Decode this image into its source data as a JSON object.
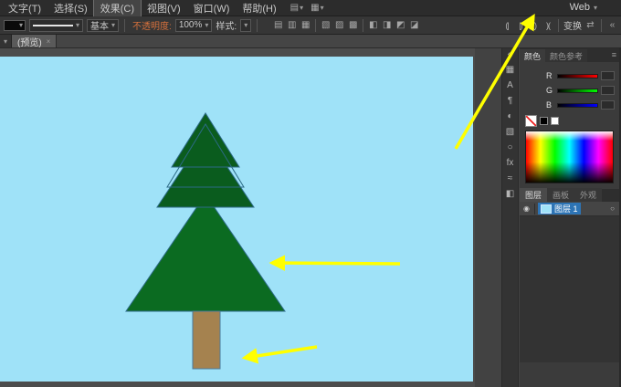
{
  "menu_bar": {
    "items": [
      "文字(T)",
      "选择(S)",
      "效果(C)",
      "视图(V)",
      "窗口(W)",
      "帮助(H)"
    ],
    "workspace_label": "Web"
  },
  "glyphs": {
    "down": "▾",
    "close": "×",
    "collapse": "«",
    "menu": "≡",
    "eye": "◉",
    "target": "○",
    "doc": "▤",
    "layout": "▦",
    "swap": "⇄"
  },
  "control_bar": {
    "stroke_preset": "基本",
    "opacity_label": "不透明度:",
    "opacity_value": "100%",
    "style_label": "样式:",
    "transform_label": "变换",
    "align_icons": [
      "▤",
      "▥",
      "▦"
    ],
    "distribute_icons": [
      "▧",
      "▨",
      "▩"
    ],
    "path_icons": [
      "◧",
      "◨",
      "◩",
      "◪"
    ],
    "bracket_icons": [
      "(|",
      "|)",
      "()",
      ")("
    ]
  },
  "tab_bar": {
    "tab_label": "(预览)"
  },
  "dock_icons": [
    "▦",
    "A",
    "¶",
    "◐",
    "▧",
    "○",
    "fx",
    "≈",
    "◧"
  ],
  "panels": {
    "color": {
      "tab": "颜色",
      "tab_guide": "颜色参考",
      "channels": [
        "R",
        "G",
        "B"
      ]
    },
    "layers": {
      "tabs": [
        "图层",
        "画板",
        "外观"
      ],
      "layer_name": "图层 1"
    }
  },
  "canvas": {
    "colors": {
      "artboard": "#9fe2f8",
      "tree_dark": "#0a5c1e",
      "tree_big": "#0b6b21",
      "trunk": "#a5824f",
      "outline": "#2c6a86",
      "arrow": "#ffff00"
    }
  }
}
